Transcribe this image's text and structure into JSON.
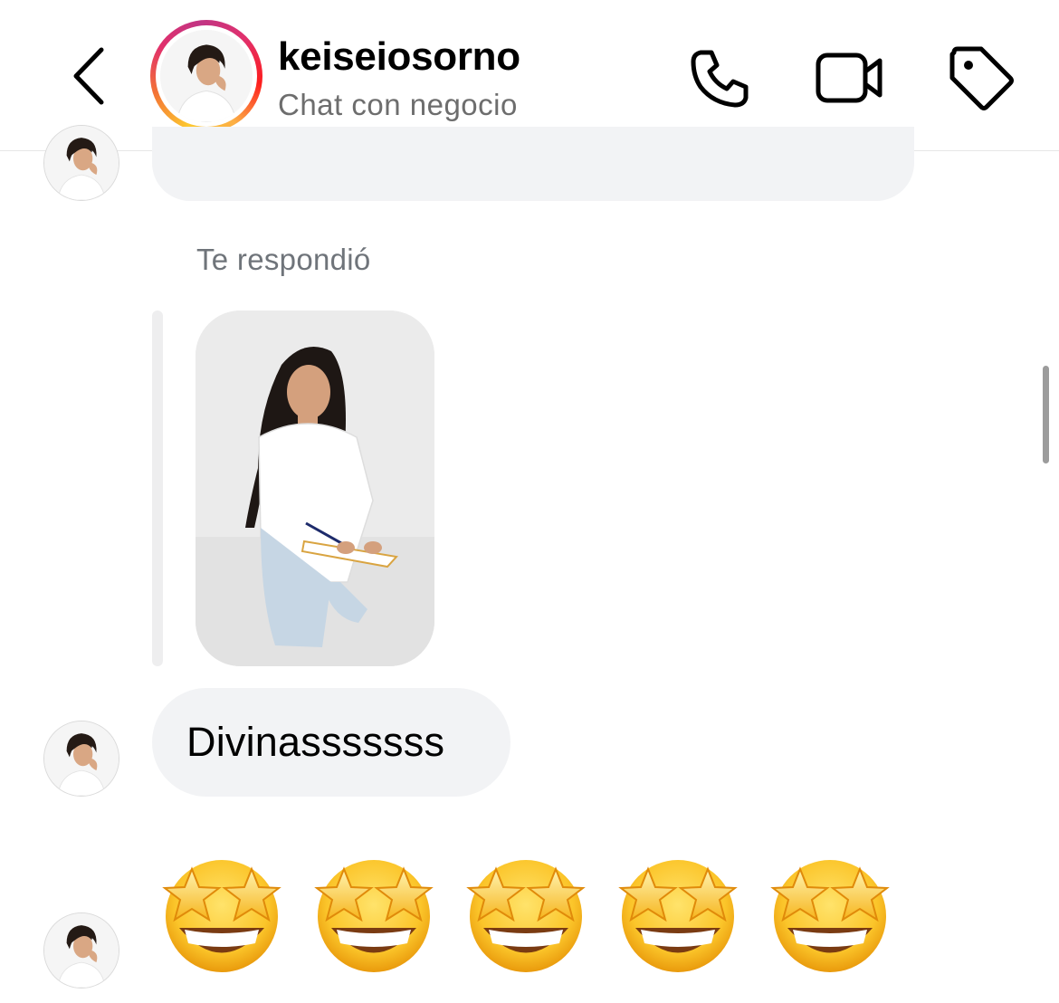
{
  "header": {
    "username": "keiseiosorno",
    "subtitle": "Chat con negocio",
    "icons": [
      "chevron-left-icon",
      "phone-icon",
      "video-camera-icon",
      "tag-icon"
    ]
  },
  "thread": {
    "reply_label": "Te respondió",
    "text_message": "Divinasssssss",
    "emoji_message": [
      "🤩",
      "🤩",
      "🤩",
      "🤩",
      "🤩"
    ]
  },
  "colors": {
    "bubble": "#f2f3f5",
    "secondary_text": "#6f747a",
    "ring_gradient": [
      "#fdc830",
      "#f37335",
      "#e1306c",
      "#c13584"
    ]
  }
}
